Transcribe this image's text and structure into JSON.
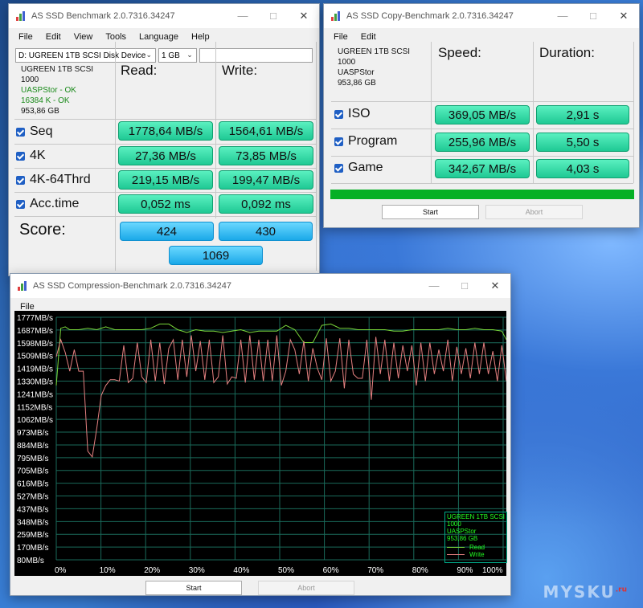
{
  "benchmark_window": {
    "title": "AS SSD Benchmark 2.0.7316.34247",
    "menu": [
      "File",
      "Edit",
      "View",
      "Tools",
      "Language",
      "Help"
    ],
    "drive_select": "D: UGREEN 1TB SCSI Disk Device",
    "size_select": "1 GB",
    "path_field": "",
    "info": {
      "line1": "UGREEN 1TB SCSI",
      "line2": "1000",
      "line3": "UASPStor - OK",
      "line4": "16384 K - OK",
      "line5": "953,86 GB"
    },
    "col_read": "Read:",
    "col_write": "Write:",
    "rows": [
      {
        "label": "Seq",
        "read": "1778,64 MB/s",
        "write": "1564,61 MB/s"
      },
      {
        "label": "4K",
        "read": "27,36 MB/s",
        "write": "73,85 MB/s"
      },
      {
        "label": "4K-64Thrd",
        "read": "219,15 MB/s",
        "write": "199,47 MB/s"
      },
      {
        "label": "Acc.time",
        "read": "0,052 ms",
        "write": "0,092 ms"
      }
    ],
    "score_label": "Score:",
    "score_read": "424",
    "score_write": "430",
    "score_total": "1069"
  },
  "copy_window": {
    "title": "AS SSD Copy-Benchmark 2.0.7316.34247",
    "menu": [
      "File",
      "Edit"
    ],
    "info": {
      "line1": "UGREEN 1TB SCSI",
      "line2": "1000",
      "line3": "UASPStor",
      "line4": "953,86 GB"
    },
    "col_speed": "Speed:",
    "col_duration": "Duration:",
    "rows": [
      {
        "label": "ISO",
        "speed": "369,05 MB/s",
        "duration": "2,91 s"
      },
      {
        "label": "Program",
        "speed": "255,96 MB/s",
        "duration": "5,50 s"
      },
      {
        "label": "Game",
        "speed": "342,67 MB/s",
        "duration": "4,03 s"
      }
    ],
    "progress": 1.0,
    "start_label": "Start",
    "abort_label": "Abort"
  },
  "compression_window": {
    "title": "AS SSD Compression-Benchmark 2.0.7316.34247",
    "menu": [
      "File"
    ],
    "start_label": "Start",
    "abort_label": "Abort",
    "legend": {
      "line1": "UGREEN 1TB SCSI",
      "line2": "1000",
      "line3": "UASPStor",
      "line4": "953,86 GB",
      "read": "Read",
      "write": "Write"
    }
  },
  "chart_data": {
    "type": "line",
    "y_tick_labels": [
      "1777MB/s",
      "1687MB/s",
      "1598MB/s",
      "1509MB/s",
      "1419MB/s",
      "1330MB/s",
      "1241MB/s",
      "1152MB/s",
      "1062MB/s",
      "973MB/s",
      "884MB/s",
      "795MB/s",
      "705MB/s",
      "616MB/s",
      "527MB/s",
      "437MB/s",
      "348MB/s",
      "259MB/s",
      "170MB/s",
      "80MB/s"
    ],
    "x_tick_labels": [
      "0%",
      "10%",
      "20%",
      "30%",
      "40%",
      "50%",
      "60%",
      "70%",
      "80%",
      "90%",
      "100%"
    ],
    "ylim": [
      80,
      1777
    ],
    "xlim": [
      0,
      100
    ],
    "colors": {
      "read": "#7ad63a",
      "write": "#e58080",
      "grid": "#1a6a5a"
    },
    "series": [
      {
        "name": "Read",
        "x": [
          0,
          1,
          2,
          3,
          5,
          7,
          9,
          11,
          13,
          15,
          17,
          19,
          21,
          23,
          25,
          27,
          29,
          31,
          33,
          35,
          37,
          39,
          41,
          43,
          45,
          47,
          49,
          51,
          53,
          55,
          57,
          59,
          61,
          63,
          65,
          67,
          69,
          71,
          73,
          75,
          77,
          79,
          81,
          83,
          85,
          87,
          89,
          91,
          93,
          95,
          97,
          99,
          100
        ],
        "values": [
          1300,
          1700,
          1710,
          1690,
          1690,
          1700,
          1690,
          1710,
          1690,
          1690,
          1690,
          1690,
          1700,
          1730,
          1730,
          1690,
          1670,
          1690,
          1680,
          1680,
          1670,
          1680,
          1690,
          1670,
          1680,
          1680,
          1680,
          1720,
          1690,
          1600,
          1600,
          1720,
          1730,
          1700,
          1700,
          1690,
          1690,
          1690,
          1690,
          1680,
          1680,
          1690,
          1690,
          1690,
          1690,
          1700,
          1690,
          1690,
          1700,
          1690,
          1690,
          1680,
          1620
        ]
      },
      {
        "name": "Write",
        "x": [
          0,
          1,
          2,
          3,
          4,
          5,
          6,
          7,
          8,
          9,
          10,
          11,
          12,
          13,
          14,
          15,
          16,
          17,
          18,
          19,
          20,
          21,
          22,
          23,
          24,
          25,
          26,
          27,
          28,
          29,
          30,
          31,
          32,
          33,
          34,
          35,
          36,
          37,
          38,
          39,
          40,
          41,
          42,
          43,
          44,
          45,
          46,
          47,
          48,
          49,
          50,
          51,
          52,
          53,
          54,
          55,
          56,
          57,
          58,
          59,
          60,
          61,
          62,
          63,
          64,
          65,
          66,
          67,
          68,
          69,
          70,
          71,
          72,
          73,
          74,
          75,
          76,
          77,
          78,
          79,
          80,
          81,
          82,
          83,
          84,
          85,
          86,
          87,
          88,
          89,
          90,
          91,
          92,
          93,
          94,
          95,
          96,
          97,
          98,
          99,
          100
        ],
        "values": [
          1500,
          1620,
          1530,
          1400,
          1550,
          1400,
          1400,
          840,
          800,
          1000,
          1230,
          1300,
          1340,
          1340,
          1330,
          1580,
          1320,
          1350,
          1600,
          1360,
          1320,
          1620,
          1330,
          1600,
          1310,
          1560,
          1620,
          1340,
          1620,
          1360,
          1650,
          1400,
          1610,
          1340,
          1620,
          1320,
          1360,
          1650,
          1310,
          1360,
          1350,
          1620,
          1320,
          1650,
          1340,
          1620,
          1330,
          1620,
          1330,
          1650,
          1300,
          1400,
          1620,
          1550,
          1380,
          1610,
          1330,
          1560,
          1420,
          1340,
          1630,
          1330,
          1400,
          1630,
          1280,
          1620,
          1380,
          1350,
          1350,
          1620,
          1200,
          1640,
          1380,
          1620,
          1330,
          1600,
          1350,
          1580,
          1400,
          1580,
          1300,
          1600,
          1330,
          1600,
          1380,
          1550,
          1400,
          1620,
          1330,
          1570,
          1380,
          1560,
          1350,
          1600,
          1380,
          1600,
          1380,
          1540,
          1330,
          1580,
          1330
        ]
      }
    ]
  }
}
